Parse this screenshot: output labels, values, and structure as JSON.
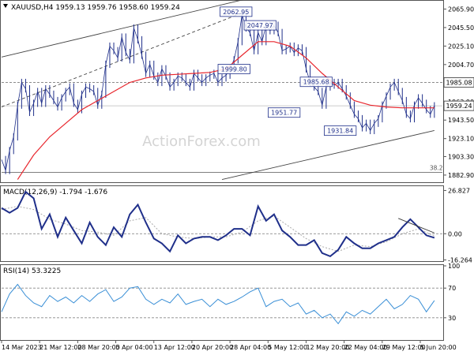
{
  "chart_data": [
    {
      "type": "line",
      "panel": "price",
      "header": "XAUUSD,H4  1959.13 1959.76 1958.60 1959.24",
      "watermark": "ActionForex.com",
      "y_axis_side": "right",
      "ylim": [
        1875.0,
        2075.0
      ],
      "y_ticks": [
        "2065.90",
        "2045.50",
        "2025.10",
        "2004.70",
        "1985.08",
        "1963.90",
        "1959.24",
        "1943.50",
        "1923.10",
        "1903.30",
        "1882.90"
      ],
      "x_ticks": [
        "14 Mar 2023",
        "21 Mar 12:00",
        "28 Mar 20:00",
        "5 Apr 04:00",
        "13 Apr 12:00",
        "20 Apr 20:00",
        "28 Apr 04:00",
        "5 May 12:00",
        "12 May 20:00",
        "22 May 04:00",
        "29 May 12:00",
        "5 Jun 20:00"
      ],
      "x_range": [
        0,
        110
      ],
      "current_price": 1959.24,
      "annotations": [
        {
          "label": "2062.95",
          "x": 58.5,
          "y": 2062.95
        },
        {
          "label": "2047.97",
          "x": 64.5,
          "y": 2047.97
        },
        {
          "label": "1999.80",
          "x": 58.0,
          "y": 1999.8
        },
        {
          "label": "1985.68",
          "x": 78.5,
          "y": 1985.68
        },
        {
          "label": "1951.77",
          "x": 70.5,
          "y": 1951.77
        },
        {
          "label": "1931.84",
          "x": 84.5,
          "y": 1931.84
        },
        {
          "label": "38.2",
          "x": 108,
          "y": 1888.5
        }
      ],
      "horizontal_levels": [
        {
          "label": "1985.08",
          "y": 1985.08,
          "style": "dashed",
          "color": "#666666"
        },
        {
          "label": "1959.24",
          "y": 1959.24,
          "style": "solid",
          "color": "#bbbbbb"
        },
        {
          "label": "38.2",
          "y": 1886.0,
          "style": "solid",
          "color": "#555555"
        }
      ],
      "trendlines": [
        {
          "name": "channel-upper",
          "from": [
            0,
            2013
          ],
          "to": [
            62,
            2078
          ],
          "style": "solid"
        },
        {
          "name": "channel-mid",
          "from": [
            0,
            1958
          ],
          "to": [
            62,
            2065
          ],
          "style": "dashed"
        },
        {
          "name": "channel-lower",
          "from": [
            55,
            1878
          ],
          "to": [
            108,
            1932
          ],
          "style": "solid"
        }
      ],
      "series": [
        {
          "kind": "price",
          "color": "#1f2f8a",
          "x": [
            0,
            1,
            2,
            3,
            4,
            5,
            6,
            7,
            8,
            9,
            10,
            11,
            12,
            13,
            14,
            15,
            16,
            17,
            18,
            19,
            20,
            21,
            22,
            23,
            24,
            25,
            26,
            27,
            28,
            29,
            30,
            31,
            32,
            33,
            34,
            35,
            36,
            37,
            38,
            39,
            40,
            41,
            42,
            43,
            44,
            45,
            46,
            47,
            48,
            49,
            50,
            51,
            52,
            53,
            54,
            55,
            56,
            57,
            58,
            59,
            60,
            61,
            62,
            63,
            64,
            65,
            66,
            67,
            68,
            69,
            70,
            71,
            72,
            73,
            74,
            75,
            76,
            77,
            78,
            79,
            80,
            81,
            82,
            83,
            84,
            85,
            86,
            87,
            88,
            89,
            90,
            91,
            92,
            93,
            94,
            95,
            96,
            97,
            98,
            99,
            100,
            101,
            102,
            103,
            104,
            105,
            106,
            107,
            108
          ],
          "values": [
            1900,
            1888,
            1910,
            1925,
            1960,
            1985,
            1978,
            1952,
            1962,
            1975,
            1962,
            1978,
            1972,
            1965,
            1958,
            1968,
            1975,
            1980,
            1962,
            1955,
            1972,
            1980,
            1978,
            1975,
            1960,
            1972,
            2005,
            2025,
            2020,
            2012,
            2035,
            2018,
            2010,
            2045,
            2032,
            2015,
            1995,
            2005,
            1992,
            1985,
            2000,
            1992,
            1980,
            1985,
            1992,
            1990,
            1985,
            1980,
            1995,
            1990,
            1985,
            1990,
            1993,
            1995,
            1985,
            1990,
            1993,
            2000,
            2010,
            2030,
            2060,
            2045,
            2040,
            2020,
            2040,
            2030,
            2048,
            2042,
            2048,
            2040,
            2020,
            2022,
            2025,
            2018,
            2023,
            2020,
            2000,
            1985,
            1980,
            1975,
            1960,
            1980,
            1985,
            1982,
            1985,
            1978,
            1970,
            1960,
            1950,
            1945,
            1935,
            1940,
            1932,
            1940,
            1945,
            1960,
            1970,
            1980,
            1985,
            1975,
            1965,
            1950,
            1945,
            1960,
            1968,
            1962,
            1955,
            1950,
            1959.24
          ]
        },
        {
          "kind": "moving-average",
          "color": "#e8262d",
          "x": [
            4,
            8,
            12,
            16,
            20,
            24,
            28,
            32,
            36,
            40,
            44,
            48,
            52,
            56,
            60,
            64,
            68,
            72,
            76,
            80,
            84,
            88,
            92,
            96,
            100,
            104,
            108
          ],
          "values": [
            1878,
            1905,
            1925,
            1940,
            1955,
            1965,
            1975,
            1985,
            1990,
            1993,
            1994,
            1995,
            1996,
            2000,
            2015,
            2030,
            2030,
            2025,
            2012,
            1995,
            1980,
            1965,
            1960,
            1958,
            1957,
            1957,
            1957
          ]
        }
      ]
    },
    {
      "type": "line",
      "panel": "macd",
      "header": "MACD(12,26,9) -1.794 -1.676",
      "ylim": [
        -17,
        29
      ],
      "y_ticks": [
        "26.827",
        "0.00",
        "-16.264"
      ],
      "zero_line": 0,
      "series": [
        {
          "kind": "macd",
          "color": "#1f2f8a",
          "x": [
            0,
            2,
            4,
            6,
            8,
            10,
            12,
            14,
            16,
            18,
            20,
            22,
            24,
            26,
            28,
            30,
            32,
            34,
            36,
            38,
            40,
            42,
            44,
            46,
            48,
            50,
            52,
            54,
            56,
            58,
            60,
            62,
            64,
            66,
            68,
            70,
            72,
            74,
            76,
            78,
            80,
            82,
            84,
            86,
            88,
            90,
            92,
            94,
            96,
            98,
            100,
            102,
            104,
            106,
            108
          ],
          "values": [
            16,
            13,
            16,
            26,
            22,
            3,
            12,
            -2,
            10,
            2,
            -6,
            7,
            -2,
            -7,
            4,
            -2,
            12,
            18,
            7,
            -3,
            -6,
            -11,
            -1,
            -6,
            -3,
            -2,
            -2,
            -4,
            -1,
            3,
            3,
            -1,
            17,
            8,
            12,
            2,
            -2,
            -7,
            -7,
            -4,
            -12,
            -14,
            -10,
            -2,
            -6,
            -9,
            -9,
            -6,
            -4,
            -2,
            4,
            9,
            4,
            -1,
            -2.5
          ]
        },
        {
          "kind": "signal",
          "color": "#aaaaaa",
          "x": [
            0,
            4,
            8,
            12,
            16,
            20,
            24,
            28,
            32,
            36,
            40,
            44,
            48,
            52,
            56,
            60,
            64,
            68,
            72,
            76,
            80,
            84,
            88,
            92,
            96,
            100,
            104,
            108
          ],
          "values": [
            15,
            17,
            15,
            9,
            6,
            2,
            1,
            -1,
            8,
            10,
            0,
            -2,
            -3,
            -2,
            -2,
            1,
            8,
            11,
            4,
            -3,
            -8,
            -11,
            -7,
            -8,
            -5,
            0,
            3,
            -1.5
          ]
        }
      ],
      "annotations": [
        {
          "label": "macd-trendline",
          "from": [
            99,
            9.5
          ],
          "to": [
            108,
            0.5
          ],
          "style": "solid"
        }
      ]
    },
    {
      "type": "line",
      "panel": "rsi",
      "header": "RSI(14) 53.3225",
      "ylim": [
        0,
        100
      ],
      "y_ticks": [
        "100",
        "70",
        "30",
        "0"
      ],
      "levels": [
        70,
        30
      ],
      "series": [
        {
          "kind": "rsi",
          "color": "#3a8fd6",
          "x": [
            0,
            2,
            4,
            6,
            8,
            10,
            12,
            14,
            16,
            18,
            20,
            22,
            24,
            26,
            28,
            30,
            32,
            34,
            36,
            38,
            40,
            42,
            44,
            46,
            48,
            50,
            52,
            54,
            56,
            58,
            60,
            62,
            64,
            66,
            68,
            70,
            72,
            74,
            76,
            78,
            80,
            82,
            84,
            86,
            88,
            90,
            92,
            94,
            96,
            98,
            100,
            102,
            104,
            106,
            108
          ],
          "values": [
            38,
            62,
            75,
            60,
            50,
            45,
            60,
            52,
            58,
            50,
            60,
            52,
            62,
            68,
            52,
            58,
            70,
            72,
            55,
            48,
            55,
            50,
            62,
            48,
            52,
            55,
            45,
            55,
            48,
            52,
            58,
            65,
            70,
            45,
            52,
            55,
            45,
            50,
            35,
            40,
            30,
            35,
            22,
            38,
            32,
            40,
            35,
            45,
            55,
            42,
            48,
            60,
            55,
            38,
            53.32
          ]
        }
      ]
    }
  ]
}
